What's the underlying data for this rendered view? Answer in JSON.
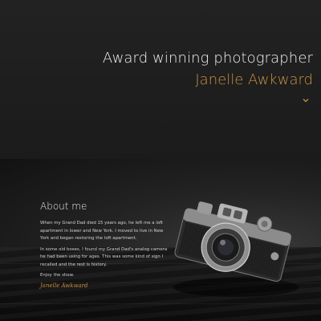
{
  "hero": {
    "title": "Award winning photographer",
    "name": "Janelle Awkward",
    "scroll_icon": "chevron-down-icon"
  },
  "about": {
    "heading": "About me",
    "paragraphs": [
      "When my Grand Dad died 15 years ago, he left me a loft apartment in lower and New York. I moved to live in New York and began restoring the loft apartment.",
      "In some old boxes, I found my Grand Dad's analog camera he had been using for ages. This was some kind of sign I recalled and the rest is history.",
      "Enjoy the show."
    ],
    "signature": "Janelle Awkward",
    "camera_icon": "camera-icon"
  },
  "colors": {
    "accent": "#c9923f",
    "hero_bg": "#222222",
    "text": "#f0f0f0"
  }
}
